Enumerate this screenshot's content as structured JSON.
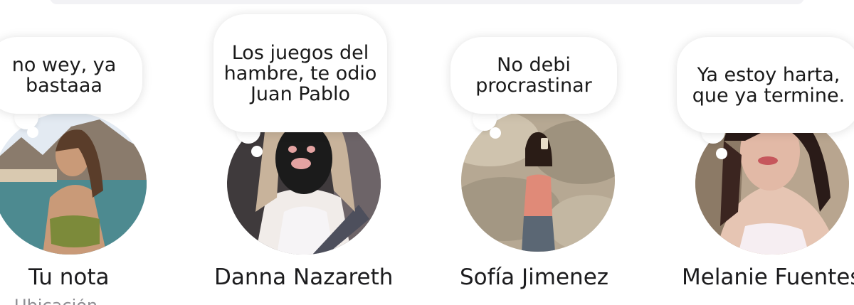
{
  "notes": [
    {
      "bubble_text": "no wey, ya bastaaa",
      "name": "Tu nota",
      "subtitle": "Ubicación",
      "is_own": true,
      "avatar_icon": "user-avatar-icon"
    },
    {
      "bubble_text": "Los juegos del hambre, te odio Juan Pablo",
      "name": "Danna Nazareth",
      "is_own": false,
      "avatar_icon": "user-avatar-icon"
    },
    {
      "bubble_text": "No debi procrastinar",
      "name": "Sofía Jimenez",
      "is_own": false,
      "avatar_icon": "user-avatar-icon"
    },
    {
      "bubble_text": "Ya estoy harta, que ya termine.",
      "name": "Melanie Fuentes",
      "is_own": false,
      "avatar_icon": "user-avatar-icon"
    }
  ],
  "colors": {
    "background": "#ffffff",
    "bubble": "#ffffff",
    "name_text": "#1c1c1e",
    "search_bar": "#f2f2f5"
  }
}
